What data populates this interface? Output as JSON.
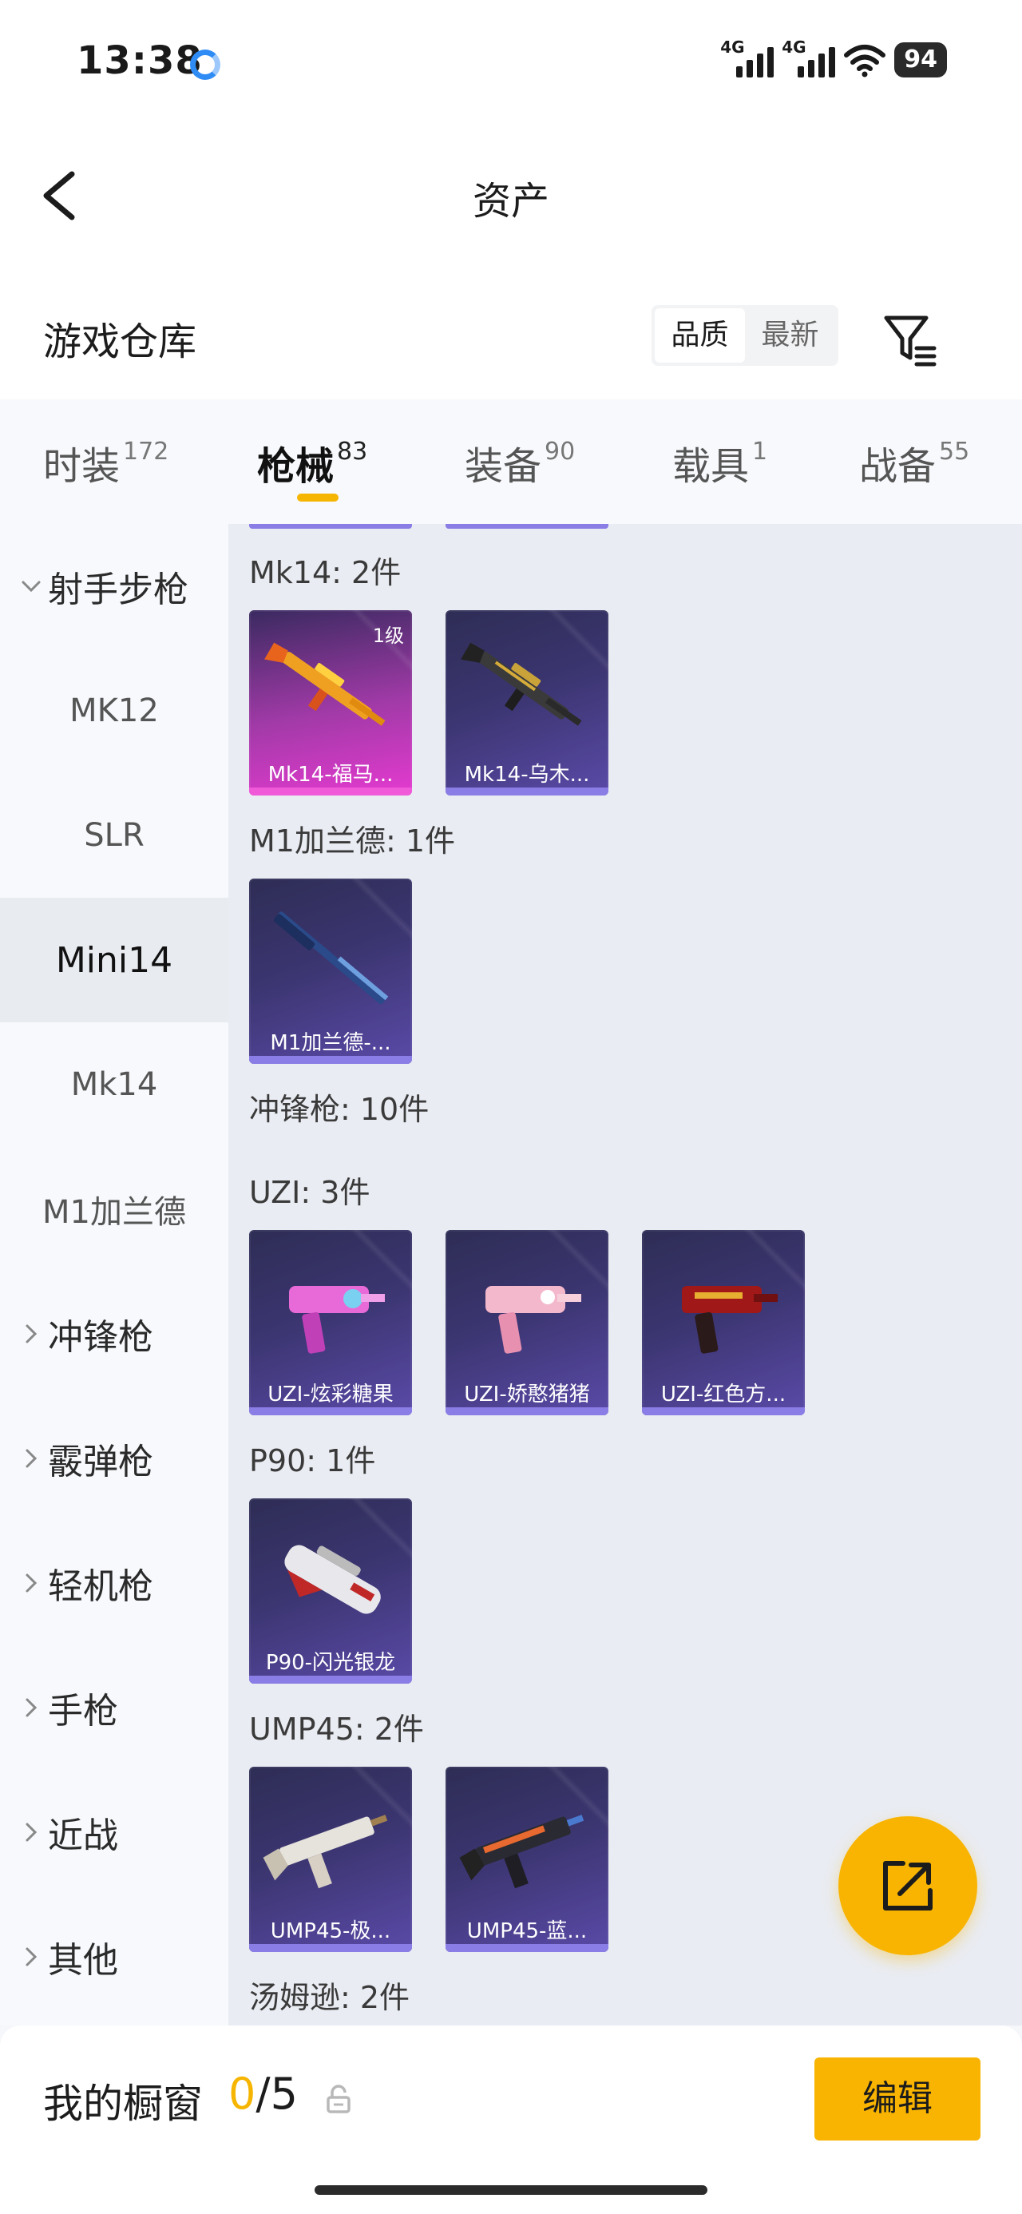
{
  "status_bar": {
    "time": "13:38",
    "signal_label_1": "4G",
    "signal_label_2": "4G",
    "battery": "94",
    "wifi_sub": "6"
  },
  "header": {
    "title": "资产"
  },
  "warehouse": {
    "title": "游戏仓库",
    "sort_options": [
      "品质",
      "最新"
    ],
    "active_sort": "品质"
  },
  "category_tabs": [
    {
      "label": "时装",
      "count": "172",
      "active": false
    },
    {
      "label": "枪械",
      "count": "83",
      "active": true
    },
    {
      "label": "装备",
      "count": "90",
      "active": false
    },
    {
      "label": "载具",
      "count": "1",
      "active": false
    },
    {
      "label": "战备",
      "count": "55",
      "active": false
    }
  ],
  "sidebar": {
    "items": [
      {
        "label": "射手步枪",
        "type": "parent",
        "expanded": true
      },
      {
        "label": "MK12",
        "type": "child"
      },
      {
        "label": "SLR",
        "type": "child"
      },
      {
        "label": "Mini14",
        "type": "child",
        "selected": true
      },
      {
        "label": "Mk14",
        "type": "child"
      },
      {
        "label": "M1加兰德",
        "type": "child"
      },
      {
        "label": "冲锋枪",
        "type": "parent"
      },
      {
        "label": "霰弹枪",
        "type": "parent"
      },
      {
        "label": "轻机枪",
        "type": "parent"
      },
      {
        "label": "手枪",
        "type": "parent"
      },
      {
        "label": "近战",
        "type": "parent"
      },
      {
        "label": "其他",
        "type": "parent"
      }
    ]
  },
  "content": {
    "groups": [
      {
        "label": "Mk14: 2件",
        "items": [
          {
            "name": "Mk14-福马...",
            "level": "1级",
            "rarity": "pink"
          },
          {
            "name": "Mk14-乌木...",
            "rarity": "purple"
          }
        ]
      },
      {
        "label": "M1加兰德: 1件",
        "items": [
          {
            "name": "M1加兰德-...",
            "rarity": "purple"
          }
        ]
      },
      {
        "label": "冲锋枪: 10件",
        "items": []
      },
      {
        "label": "UZI: 3件",
        "items": [
          {
            "name": "UZI-炫彩糖果",
            "rarity": "purple"
          },
          {
            "name": "UZI-娇憨猪猪",
            "rarity": "purple"
          },
          {
            "name": "UZI-红色方...",
            "rarity": "purple"
          }
        ]
      },
      {
        "label": "P90: 1件",
        "items": [
          {
            "name": "P90-闪光银龙",
            "rarity": "purple"
          }
        ]
      },
      {
        "label": "UMP45: 2件",
        "items": [
          {
            "name": "UMP45-极...",
            "rarity": "purple"
          },
          {
            "name": "UMP45-蓝...",
            "rarity": "purple"
          }
        ]
      },
      {
        "label": "汤姆逊: 2件",
        "items": []
      }
    ]
  },
  "bottom_bar": {
    "label": "我的橱窗",
    "count_current": "0",
    "count_sep": "/",
    "count_total": "5",
    "edit_label": "编辑"
  },
  "colors": {
    "accent": "#f8b400",
    "card_purple": "#3b3570",
    "card_pink": "#e53ad0"
  },
  "icons": [
    "back-arrow-icon",
    "filter-icon",
    "share-icon",
    "lock-icon",
    "wifi-icon",
    "signal-icon",
    "chevron-down-icon",
    "chevron-right-icon"
  ]
}
